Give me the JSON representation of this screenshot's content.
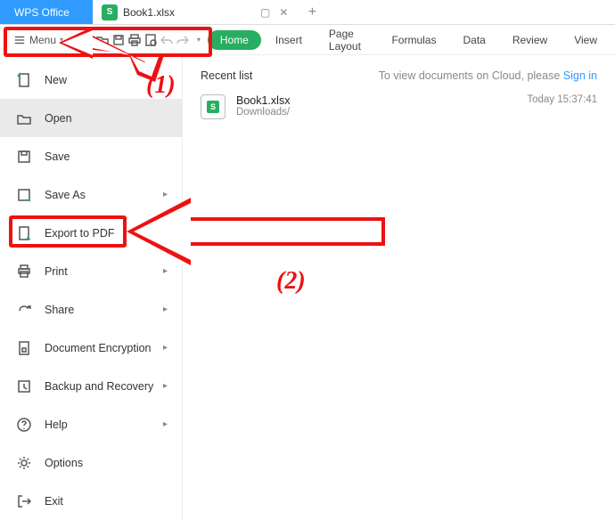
{
  "app": {
    "title": "WPS Office"
  },
  "tab": {
    "icon_letter": "S",
    "filename": "Book1.xlsx"
  },
  "toolbar": {
    "menu_label": "Menu"
  },
  "ribbon": {
    "home": "Home",
    "insert": "Insert",
    "page_layout": "Page Layout",
    "formulas": "Formulas",
    "data": "Data",
    "review": "Review",
    "view": "View"
  },
  "menu": {
    "new": "New",
    "open": "Open",
    "save": "Save",
    "save_as": "Save As",
    "export_pdf": "Export to PDF",
    "print": "Print",
    "share": "Share",
    "encryption": "Document Encryption",
    "backup": "Backup and Recovery",
    "help": "Help",
    "options": "Options",
    "exit": "Exit"
  },
  "recent": {
    "heading": "Recent list",
    "cloud_prompt": "To view documents on Cloud, please ",
    "signin": "Sign in",
    "items": [
      {
        "name": "Book1.xlsx",
        "path": "Downloads/",
        "time": "Today 15:37:41"
      }
    ]
  },
  "annotations": {
    "step1": "(1)",
    "step2": "(2)"
  }
}
